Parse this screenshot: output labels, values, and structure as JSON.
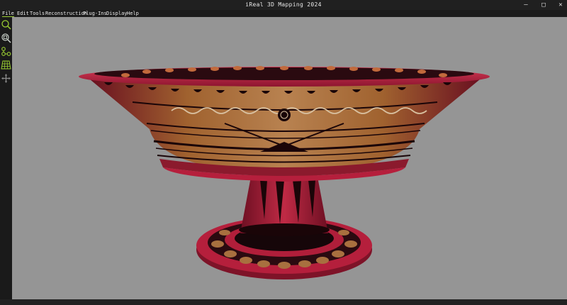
{
  "window": {
    "title": "iReal 3D Mapping 2024"
  },
  "menu": [
    "File",
    "Edit",
    "Tools",
    "Reconstruction",
    "Plug-Ins",
    "Display",
    "Help"
  ],
  "toolbar": {
    "tools": [
      "search-icon",
      "zoom-fit-icon",
      "connect-points-icon",
      "grid-mesh-icon",
      "move-icon"
    ]
  },
  "colors": {
    "accent": "#9acd32",
    "viewport_bg": "#959595",
    "vase_red": "#b01e3a",
    "vase_tan": "#b0784a"
  }
}
